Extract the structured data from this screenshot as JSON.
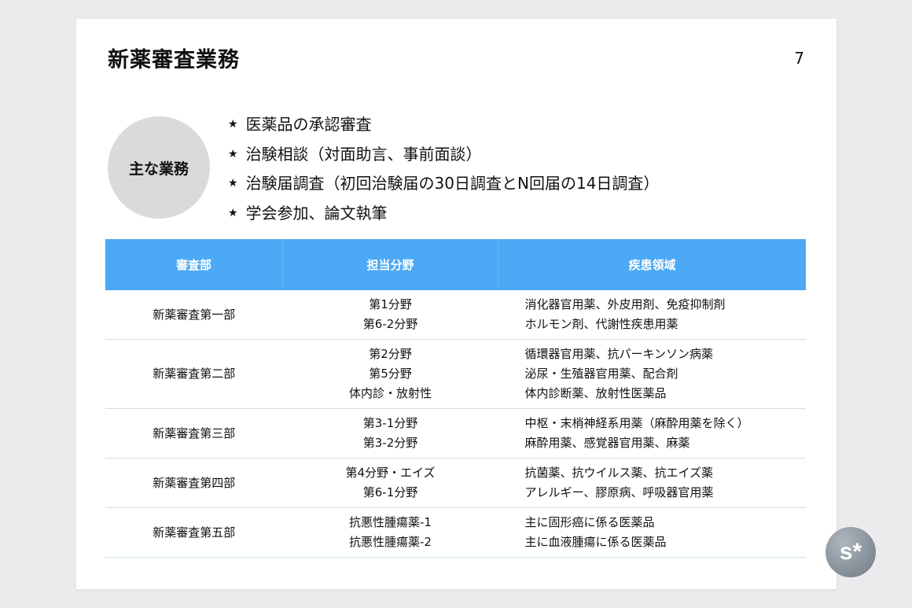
{
  "slide": {
    "title": "新薬審査業務",
    "page_number": "7"
  },
  "main_duties": {
    "label": "主な業務",
    "bullet_icon": "star-icon",
    "items": [
      "医薬品の承認審査",
      "治験相談（対面助言、事前面談）",
      "治験届調査（初回治験届の30日調査とN回届の14日調査）",
      "学会参加、論文執筆"
    ]
  },
  "table": {
    "header_color": "#4ca9f5",
    "headers": [
      "審査部",
      "担当分野",
      "疾患領域"
    ],
    "rows": [
      {
        "dept": "新薬審査第一部",
        "fields": [
          "第1分野",
          "第6-2分野"
        ],
        "areas": [
          "消化器官用薬、外皮用剤、免疫抑制剤",
          "ホルモン剤、代謝性疾患用薬"
        ]
      },
      {
        "dept": "新薬審査第二部",
        "fields": [
          "第2分野",
          "第5分野",
          "体内診・放射性"
        ],
        "areas": [
          "循環器官用薬、抗パーキンソン病薬",
          "泌尿・生殖器官用薬、配合剤",
          "体内診断薬、放射性医薬品"
        ]
      },
      {
        "dept": "新薬審査第三部",
        "fields": [
          "第3-1分野",
          "第3-2分野"
        ],
        "areas": [
          "中枢・末梢神経系用薬（麻酔用薬を除く）",
          "麻酔用薬、感覚器官用薬、麻薬"
        ]
      },
      {
        "dept": "新薬審査第四部",
        "fields": [
          "第4分野・エイズ",
          "第6-1分野"
        ],
        "areas": [
          "抗菌薬、抗ウイルス薬、抗エイズ薬",
          "アレルギー、膠原病、呼吸器官用薬"
        ]
      },
      {
        "dept": "新薬審査第五部",
        "fields": [
          "抗悪性腫瘍薬-1",
          "抗悪性腫瘍薬-2"
        ],
        "areas": [
          "主に固形癌に係る医薬品",
          "主に血液腫瘍に係る医薬品"
        ]
      }
    ]
  },
  "logo": {
    "text": "s*",
    "icon": "speakerdeck-logo-icon"
  }
}
